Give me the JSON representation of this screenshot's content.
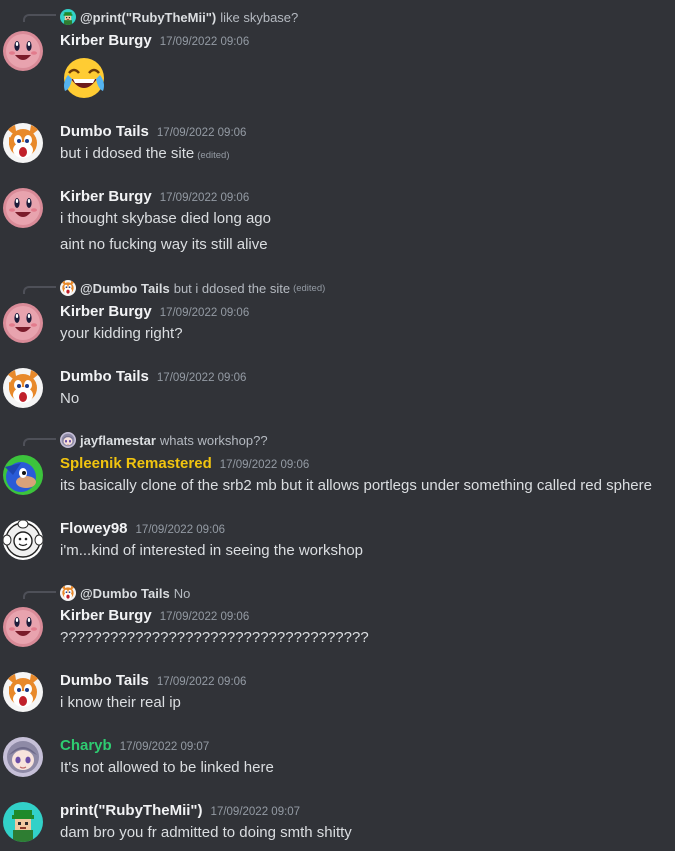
{
  "colors": {
    "background": "#313338",
    "text": "#dbdee1",
    "timestamp": "#949ba4",
    "spleenik_name": "#f1c40f",
    "charyb_name": "#2ecc71"
  },
  "messages": [
    {
      "reply": {
        "author": "@print(\"RubyTheMii\")",
        "text": "like skybase?"
      },
      "author": "Kirber Burgy",
      "timestamp": "17/09/2022 09:06",
      "lines": [],
      "emoji": "joy-emoji",
      "avatar": "kirby-avatar"
    },
    {
      "author": "Dumbo Tails",
      "timestamp": "17/09/2022 09:06",
      "lines": [
        "but i ddosed the site"
      ],
      "edited": "(edited)",
      "avatar": "tails-avatar"
    },
    {
      "author": "Kirber Burgy",
      "timestamp": "17/09/2022 09:06",
      "lines": [
        "i thought skybase died long ago",
        "aint no fucking way its still alive"
      ],
      "avatar": "kirby-avatar"
    },
    {
      "reply": {
        "author": "@Dumbo Tails",
        "text": "but i ddosed the site",
        "edited": "(edited)"
      },
      "author": "Kirber Burgy",
      "timestamp": "17/09/2022 09:06",
      "lines": [
        "your kidding right?"
      ],
      "avatar": "kirby-avatar"
    },
    {
      "author": "Dumbo Tails",
      "timestamp": "17/09/2022 09:06",
      "lines": [
        "No"
      ],
      "avatar": "tails-avatar"
    },
    {
      "reply": {
        "author": "jayflamestar",
        "text": "whats workshop??"
      },
      "author": "Spleenik Remastered",
      "timestamp": "17/09/2022 09:06",
      "lines": [
        "its basically clone of the srb2 mb but it allows  portlegs under something called red sphere"
      ],
      "avatar": "spleenik-avatar"
    },
    {
      "author": "Flowey98",
      "timestamp": "17/09/2022 09:06",
      "lines": [
        "i'm...kind of interested in seeing the workshop"
      ],
      "avatar": "flowey-avatar"
    },
    {
      "reply": {
        "author": "@Dumbo Tails",
        "text": "No"
      },
      "author": "Kirber Burgy",
      "timestamp": "17/09/2022 09:06",
      "lines": [
        "?????????????????????????????????????"
      ],
      "avatar": "kirby-avatar"
    },
    {
      "author": "Dumbo Tails",
      "timestamp": "17/09/2022 09:06",
      "lines": [
        "i know their real ip"
      ],
      "avatar": "tails-avatar"
    },
    {
      "author": "Charyb",
      "timestamp": "17/09/2022 09:07",
      "lines": [
        "It's not allowed to be linked here"
      ],
      "avatar": "charyb-avatar"
    },
    {
      "author": "print(\"RubyTheMii\")",
      "timestamp": "17/09/2022 09:07",
      "lines": [
        "dam bro you fr admitted to doing smth shitty"
      ],
      "avatar": "ruby-avatar"
    }
  ]
}
